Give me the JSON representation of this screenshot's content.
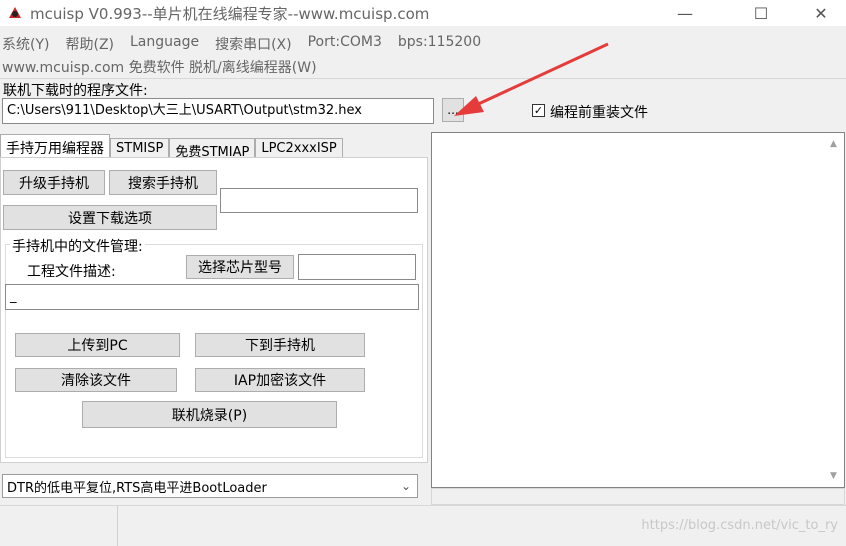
{
  "window": {
    "title": "mcuisp V0.993--单片机在线编程专家--www.mcuisp.com",
    "minimize_glyph": "—",
    "maximize_glyph": "☐",
    "close_glyph": "✕"
  },
  "menu": {
    "items": [
      "系统(Y)",
      "帮助(Z)",
      "Language",
      "搜索串口(X)",
      "Port:COM3",
      "bps:115200"
    ],
    "line2": "www.mcuisp.com 免费软件 脱机/离线编程器(W)"
  },
  "file": {
    "label": "联机下载时的程序文件:",
    "path": "C:\\Users\\911\\Desktop\\大三上\\USART\\Output\\stm32.hex",
    "browse_label": "...",
    "reload_checkbox_label": "编程前重装文件",
    "reload_checked": "✓"
  },
  "tabs": [
    "手持万用编程器",
    "STMISP",
    "免费STMIAP",
    "LPC2xxxISP"
  ],
  "handheld": {
    "upgrade_button": "升级手持机",
    "search_button": "搜索手持机",
    "settings_button": "设置下载选项",
    "group_title": "手持机中的文件管理:",
    "project_desc_label": "工程文件描述:",
    "select_chip_button": "选择芯片型号",
    "project_desc_value": "_",
    "upload_pc_button": "上传到PC",
    "download_handheld_button": "下到手持机",
    "clear_file_button": "清除该文件",
    "iap_encrypt_button": "IAP加密该文件",
    "online_burn_button": "联机烧录(P)"
  },
  "bootmode": {
    "selected": "DTR的低电平复位,RTS高电平进BootLoader"
  },
  "output": {
    "scroll_up": "▲",
    "scroll_down": "▼"
  },
  "watermark": "https://blog.csdn.net/vic_to_ry",
  "colors": {
    "arrow": "#e63b3b",
    "window_bg": "#f0f0f0"
  }
}
